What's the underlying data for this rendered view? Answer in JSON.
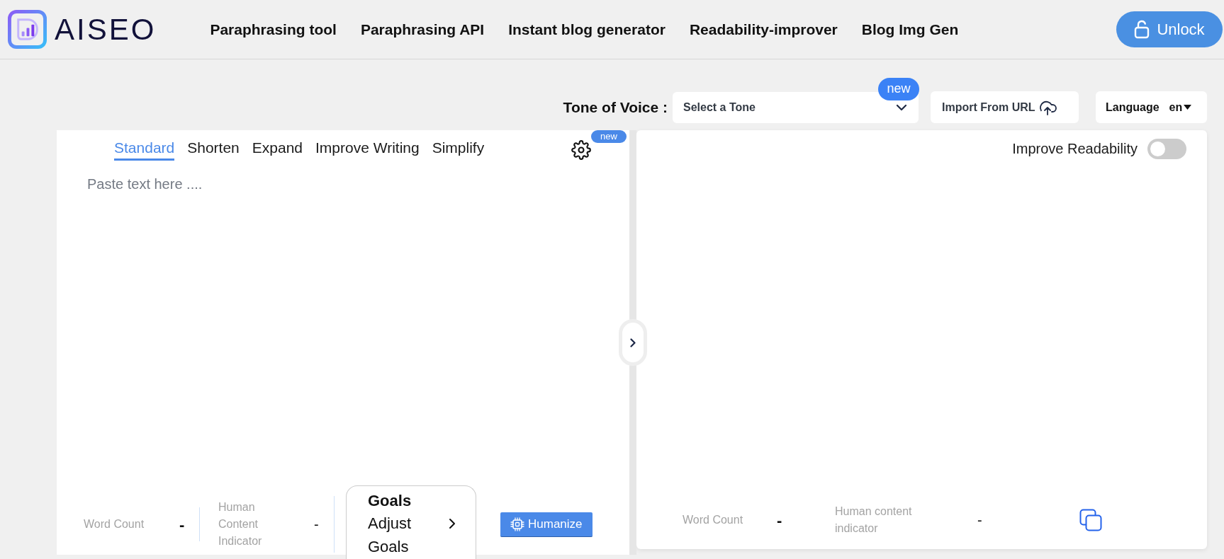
{
  "header": {
    "logo": "AISEO",
    "nav": [
      "Paraphrasing tool",
      "Paraphrasing API",
      "Instant blog generator",
      "Readability-improver",
      "Blog Img Gen"
    ],
    "unlock_button": "Unlock"
  },
  "toolbar": {
    "tone": {
      "label": "Tone of Voice :",
      "value": "Select a Tone",
      "badge": "new"
    },
    "import_button": "Import From URL",
    "language": {
      "label": "Language",
      "value": "en"
    }
  },
  "input_panel": {
    "tabs": [
      {
        "label": "Standard",
        "selected": true
      },
      {
        "label": "Shorten",
        "selected": false
      },
      {
        "label": "Expand",
        "selected": false
      },
      {
        "label": "Improve Writing",
        "selected": false
      },
      {
        "label": "Simplify",
        "selected": false
      }
    ],
    "settings_badge": "new",
    "text_field": {
      "placeholder": "Paste text here ...."
    },
    "stats": [
      {
        "label": "Word Count",
        "value": "-"
      },
      {
        "label": "Human Content Indicator",
        "value": "-"
      }
    ],
    "goals": {
      "title": "Goals",
      "link": "Adjust Goals"
    },
    "humanize_button": "Humanize"
  },
  "output_panel": {
    "readability_toggle": {
      "label": "Improve Readability",
      "on": false
    },
    "stats": [
      {
        "label": "Word Count",
        "value": "-"
      },
      {
        "label": "Human content indicator",
        "value": "-"
      }
    ]
  }
}
